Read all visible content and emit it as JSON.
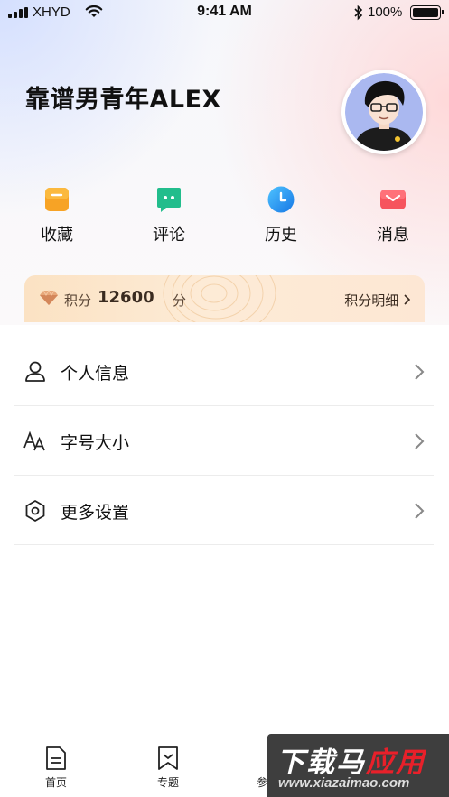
{
  "status_bar": {
    "carrier": "XHYD",
    "time": "9:41 AM",
    "battery": "100%"
  },
  "profile": {
    "username": "靠谱男青年ALEX",
    "avatar_icon": "avatar-illustration"
  },
  "quick_actions": [
    {
      "label": "收藏",
      "icon": "bookmark-icon",
      "color": "#f5a623"
    },
    {
      "label": "评论",
      "icon": "comment-icon",
      "color": "#27c08a"
    },
    {
      "label": "历史",
      "icon": "clock-icon",
      "color": "#2d8cf0"
    },
    {
      "label": "消息",
      "icon": "mail-icon",
      "color": "#f5525c"
    }
  ],
  "points": {
    "label": "积分",
    "value": "12600",
    "unit": "分",
    "detail_link": "积分明细",
    "accent": "#fbe2c3"
  },
  "menu": [
    {
      "label": "个人信息",
      "icon": "user-icon"
    },
    {
      "label": "字号大小",
      "icon": "font-size-icon"
    },
    {
      "label": "更多设置",
      "icon": "settings-hexagon-icon"
    }
  ],
  "tab_bar": [
    {
      "label": "首页",
      "icon": "home-document-icon"
    },
    {
      "label": "专题",
      "icon": "topic-bookmark-icon"
    },
    {
      "label": "参",
      "icon": ""
    }
  ],
  "watermark": {
    "title_a": "下载",
    "title_b": "马",
    "title_c": "应用",
    "url": "www.xiazaimao.com"
  }
}
